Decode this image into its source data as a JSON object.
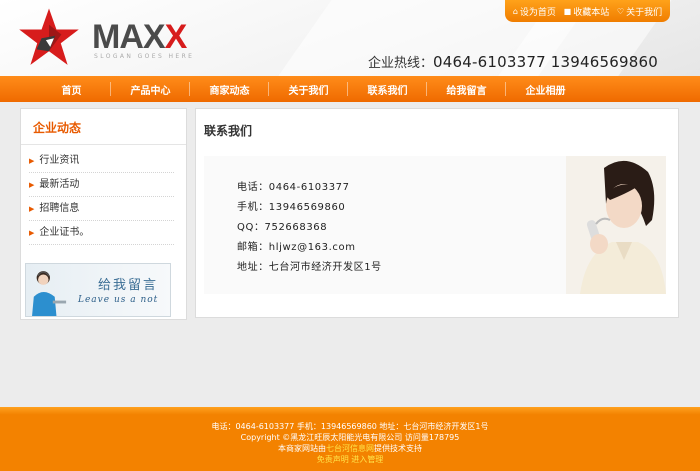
{
  "header": {
    "logo_main": "MAX",
    "logo_accent": "X",
    "slogan": "SLOGAN GOES HERE",
    "top_links": [
      {
        "label": "设为首页",
        "icon": "home-icon"
      },
      {
        "label": "收藏本站",
        "icon": "bookmark-icon"
      },
      {
        "label": "关于我们",
        "icon": "info-icon"
      }
    ],
    "hotline_label": "企业热线：",
    "hotline_numbers": "0464-6103377 13946569860"
  },
  "nav": {
    "items": [
      "首页",
      "产品中心",
      "商家动态",
      "关于我们",
      "联系我们",
      "给我留言",
      "企业相册"
    ]
  },
  "sidebar": {
    "title": "企业动态",
    "items": [
      "行业资讯",
      "最新活动",
      "招聘信息",
      "企业证书。"
    ],
    "banner_title": "给我留言",
    "banner_sub": "Leave us a not"
  },
  "main": {
    "title": "联系我们",
    "contact": [
      "电话：0464-6103377",
      "手机：13946569860",
      "QQ：752668368",
      "邮箱：hljwz@163.com",
      "地址：七台河市经济开发区1号"
    ]
  },
  "footer": {
    "line1": "电话：0464-6103377 手机：13946569860 地址：七台河市经济开发区1号",
    "line2": "Copyright ©黑龙江旺辰太阳能光电有限公司 访问量178795",
    "line3_prefix": "本商家网站由",
    "line3_link": "七台河信息网",
    "line3_suffix": "提供技术支持",
    "disclaimer": "免责声明",
    "admin": "进入管理"
  },
  "colors": {
    "accent": "#f07d00",
    "logo_red": "#d71c1c",
    "footer_link": "#ffe54a"
  }
}
